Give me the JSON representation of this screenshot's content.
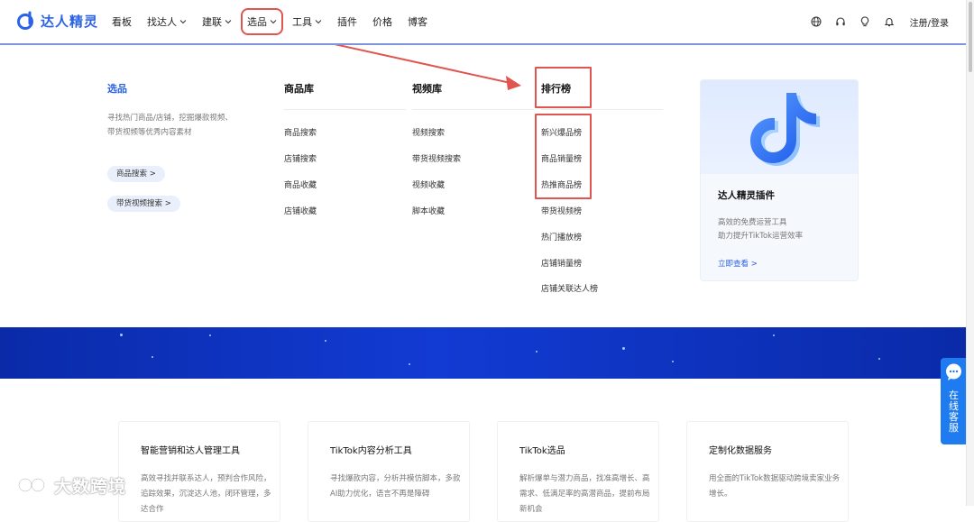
{
  "brand": {
    "name": "达人精灵",
    "accent": "#2b62e6",
    "annotation_color": "#e05550"
  },
  "nav": {
    "items": [
      {
        "label": "看板",
        "has_dropdown": false
      },
      {
        "label": "找达人",
        "has_dropdown": true
      },
      {
        "label": "建联",
        "has_dropdown": true
      },
      {
        "label": "选品",
        "has_dropdown": true,
        "active": true
      },
      {
        "label": "工具",
        "has_dropdown": true
      },
      {
        "label": "插件",
        "has_dropdown": false
      },
      {
        "label": "价格",
        "has_dropdown": false
      },
      {
        "label": "博客",
        "has_dropdown": false
      }
    ],
    "right_icons": [
      "globe-icon",
      "headset-icon",
      "lightbulb-icon",
      "bell-icon"
    ],
    "login_label": "注册/登录"
  },
  "dropdown": {
    "intro": {
      "title": "选品",
      "description": "寻找热门商品/店铺，挖掘爆款视频、带货视频等优秀内容素材",
      "buttons": [
        {
          "label": "商品搜索 >"
        },
        {
          "label": "带货视频搜索 >"
        }
      ]
    },
    "columns": [
      {
        "title": "商品库",
        "items": [
          "商品搜索",
          "店铺搜索",
          "商品收藏",
          "店铺收藏"
        ]
      },
      {
        "title": "视频库",
        "items": [
          "视频搜索",
          "带货视频搜索",
          "视频收藏",
          "脚本收藏"
        ]
      },
      {
        "title": "排行榜",
        "items": [
          "新兴爆品榜",
          "商品销量榜",
          "热推商品榜",
          "带货视频榜",
          "热门播放榜",
          "店铺销量榜",
          "店铺关联达人榜"
        ]
      }
    ],
    "plugin_card": {
      "title": "达人精灵插件",
      "description_lines": [
        "高效的免费运营工具",
        "助力提升TikTok运营效率"
      ],
      "link": "立即查看 >"
    }
  },
  "features": [
    {
      "title": "智能营销和达人管理工具",
      "description": "高效寻找并联系达人，预判合作风险，追踪效果，沉淀达人池，闭环管理，多达合作"
    },
    {
      "title": "TikTok内容分析工具",
      "description": "寻找爆款内容，分析并模仿脚本，多款AI助力优化，语言不再是障碍"
    },
    {
      "title": "TikTok选品",
      "description": "解析爆单与潜力商品，找准高增长、高需求、低满足率的高潜商品，提前布局新机会"
    },
    {
      "title": "定制化数据服务",
      "description": "用全面的TikTok数据驱动跨境卖家业务增长。"
    }
  ],
  "service_tab": {
    "label": "在线客服"
  },
  "watermark": {
    "text": "大数跨境"
  }
}
